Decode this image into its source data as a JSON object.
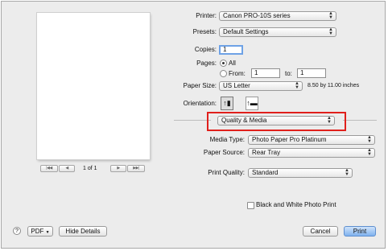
{
  "printer": {
    "label": "Printer:",
    "value": "Canon PRO-10S series"
  },
  "presets": {
    "label": "Presets:",
    "value": "Default Settings"
  },
  "copies": {
    "label": "Copies:",
    "value": "1"
  },
  "pages": {
    "label": "Pages:",
    "all_label": "All",
    "from_label": "From:",
    "from_value": "1",
    "to_label": "to:",
    "to_value": "1"
  },
  "paper_size": {
    "label": "Paper Size:",
    "value": "US Letter",
    "dimensions": "8.50 by 11.00 inches"
  },
  "orientation": {
    "label": "Orientation:",
    "portrait_glyph": "↑▮",
    "landscape_glyph": "↑▬"
  },
  "panel": {
    "value": "Quality & Media"
  },
  "media_type": {
    "label": "Media Type:",
    "value": "Photo Paper Pro Platinum"
  },
  "paper_source": {
    "label": "Paper Source:",
    "value": "Rear Tray"
  },
  "print_quality": {
    "label": "Print Quality:",
    "value": "Standard"
  },
  "bw_photo": {
    "label": "Black and White Photo Print",
    "checked": false
  },
  "preview_nav": {
    "first": "|◀◀",
    "prev": "◀",
    "page_text": "1 of 1",
    "next": "▶",
    "last": "▶▶|"
  },
  "footer": {
    "help": "?",
    "pdf": "PDF",
    "hide_details": "Hide Details",
    "cancel": "Cancel",
    "print": "Print"
  },
  "colors": {
    "highlight": "#e0201c",
    "accent": "#7fb2ee"
  }
}
